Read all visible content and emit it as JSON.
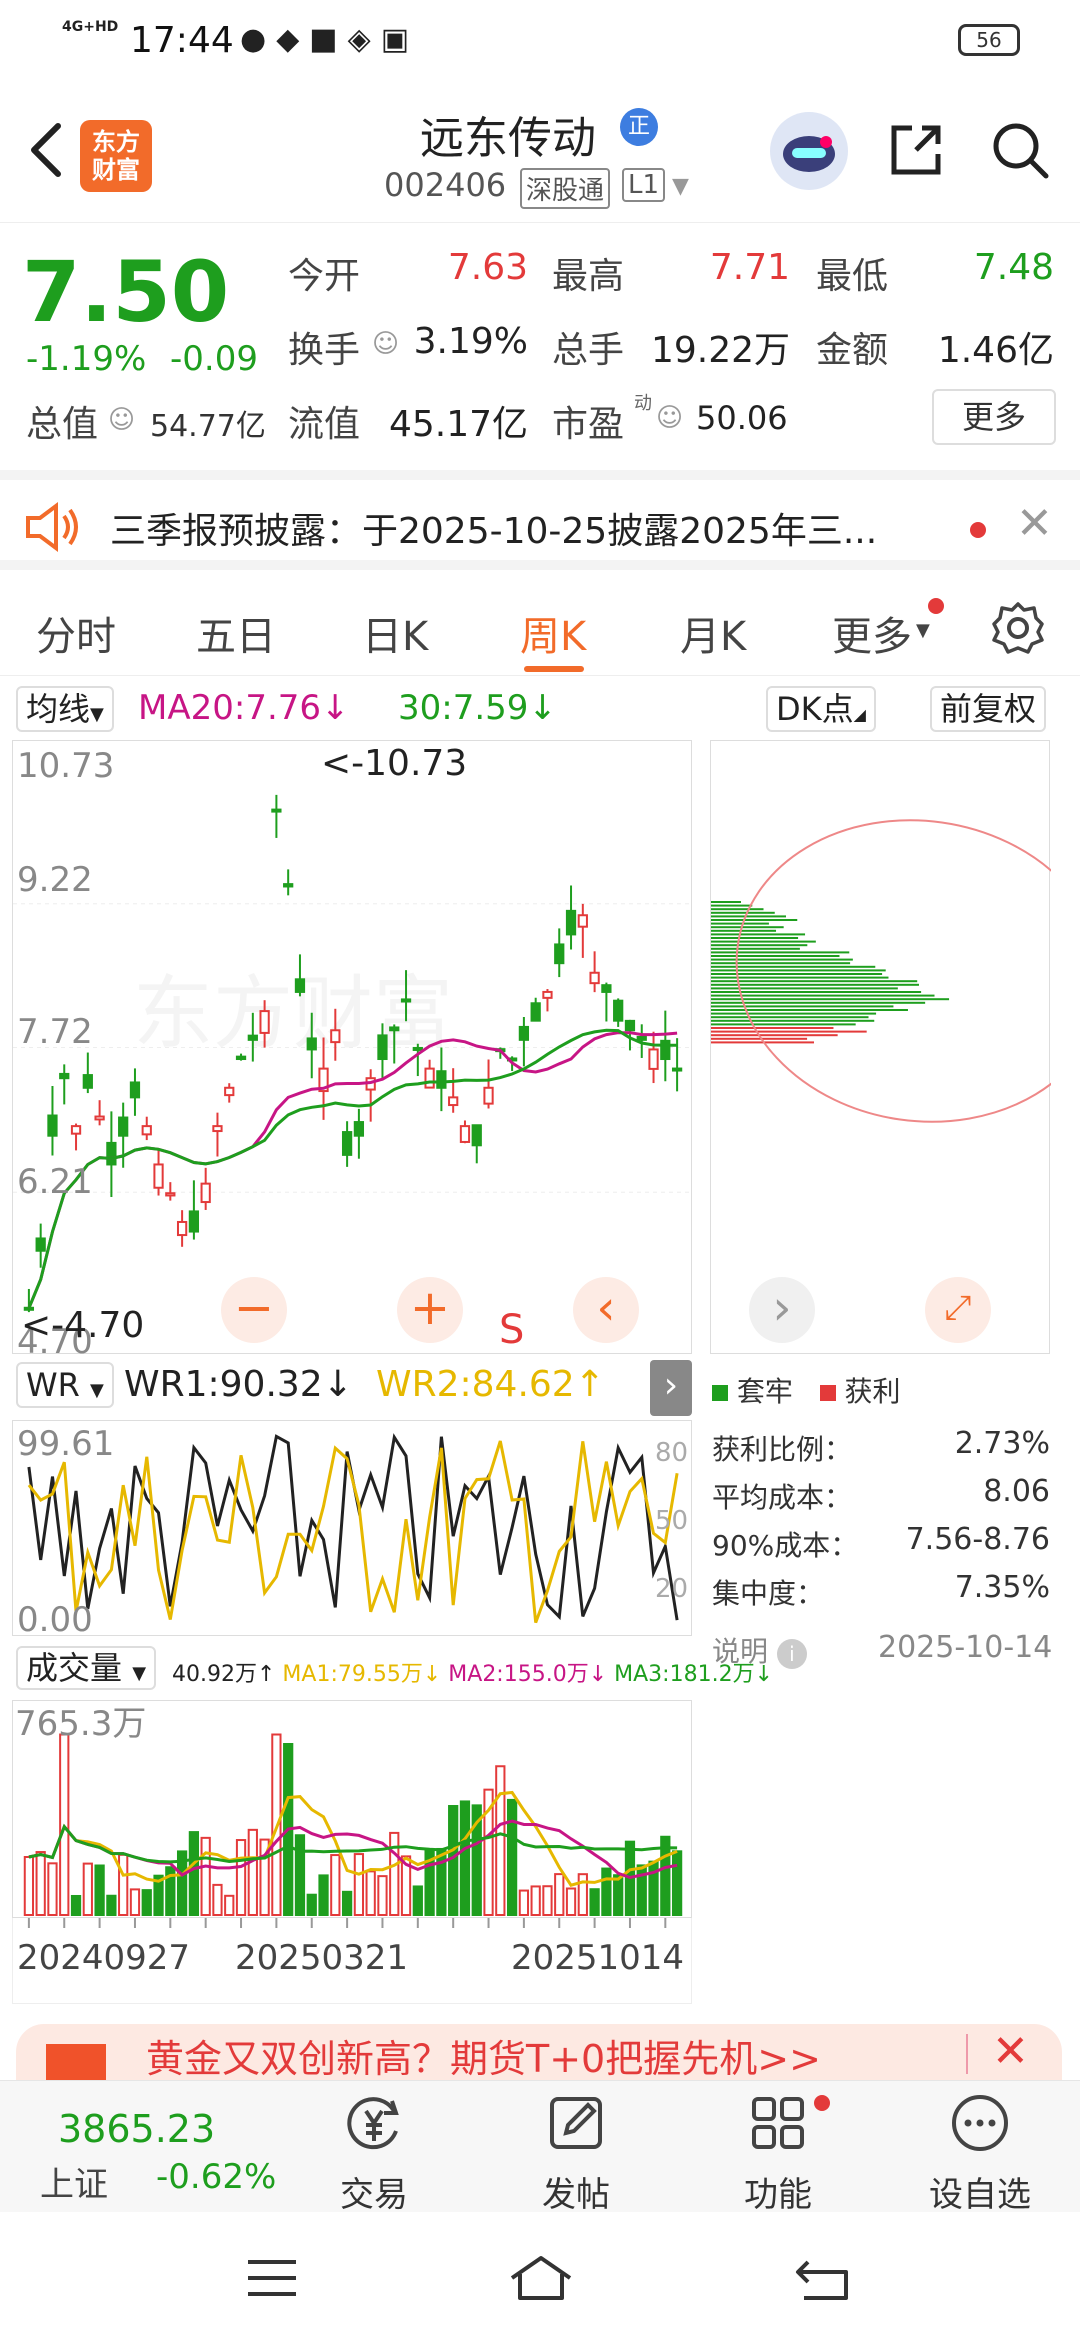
{
  "status_bar": {
    "network": "4G+HD",
    "time": "17:44",
    "battery": "56"
  },
  "header": {
    "logo_line1": "东方",
    "logo_line2": "财富",
    "stock_name": "远东传动",
    "badge": "正",
    "stock_code": "002406",
    "market": "深股通",
    "level": "L1"
  },
  "quote": {
    "price": "7.50",
    "change_pct": "-1.19%",
    "change_abs": "-0.09",
    "open_label": "今开",
    "open": "7.63",
    "high_label": "最高",
    "high": "7.71",
    "low_label": "最低",
    "low": "7.48",
    "turnover_label": "换手",
    "turnover": "3.19%",
    "volume_label": "总手",
    "volume": "19.22万",
    "amount_label": "金额",
    "amount": "1.46亿",
    "total_value_label": "总值",
    "total_value": "54.77亿",
    "float_value_label": "流值",
    "float_value": "45.17亿",
    "pe_label": "市盈",
    "pe_sup": "动",
    "pe": "50.06",
    "more_label": "更多"
  },
  "notice": {
    "text": "三季报预披露：于2025-10-25披露2025年三..."
  },
  "tabs": {
    "items": [
      "分时",
      "五日",
      "日K",
      "周K",
      "月K",
      "更多"
    ],
    "active": "周K"
  },
  "kline": {
    "indicator_select": "均线",
    "ma20": "MA20:7.76↓",
    "ma30": "30:7.59↓",
    "dk_label": "DK点",
    "fq_label": "前复权",
    "y_labels": [
      "10.73",
      "9.22",
      "7.72",
      "6.21",
      "4.70"
    ],
    "max_marker": "<-10.73",
    "min_marker": "<-4.70",
    "signal": "S",
    "watermark": "东方财富"
  },
  "wr": {
    "select": "WR",
    "wr1": "WR1:90.32↓",
    "wr2": "WR2:84.62↑",
    "top_label": "99.61",
    "bottom_label": "0.00",
    "levels": [
      "80",
      "50",
      "20"
    ]
  },
  "volume_panel": {
    "select": "成交量",
    "vol": "40.92万↑",
    "ma1": "MA1:79.55万↓",
    "ma2": "MA2:155.0万↓",
    "ma3": "MA3:181.2万↓",
    "max_label": "765.3万",
    "dates": [
      "20240927",
      "20250321",
      "20251014"
    ]
  },
  "cost": {
    "legend_trapped": "套牢",
    "legend_profit": "获利",
    "rows": [
      {
        "label": "获利比例：",
        "value": "2.73%"
      },
      {
        "label": "平均成本：",
        "value": "8.06"
      },
      {
        "label": "90%成本：",
        "value": "7.56-8.76"
      },
      {
        "label": "集中度：",
        "value": "7.35%"
      }
    ],
    "explain_label": "说明",
    "date": "2025-10-14"
  },
  "ad": {
    "text": "黄金又双创新高？期货T+0把握先机>>"
  },
  "bottom_nav": {
    "index_value": "3865.23",
    "index_name": "上证",
    "index_change": "-0.62%",
    "items": [
      "交易",
      "发帖",
      "功能",
      "设自选"
    ]
  },
  "colors": {
    "up": "#e33a3a",
    "down": "#1e9e1e",
    "accent": "#f26b2a",
    "ma20": "#c71585",
    "ma30": "#1e9e1e",
    "wr2": "#e6b800"
  }
}
